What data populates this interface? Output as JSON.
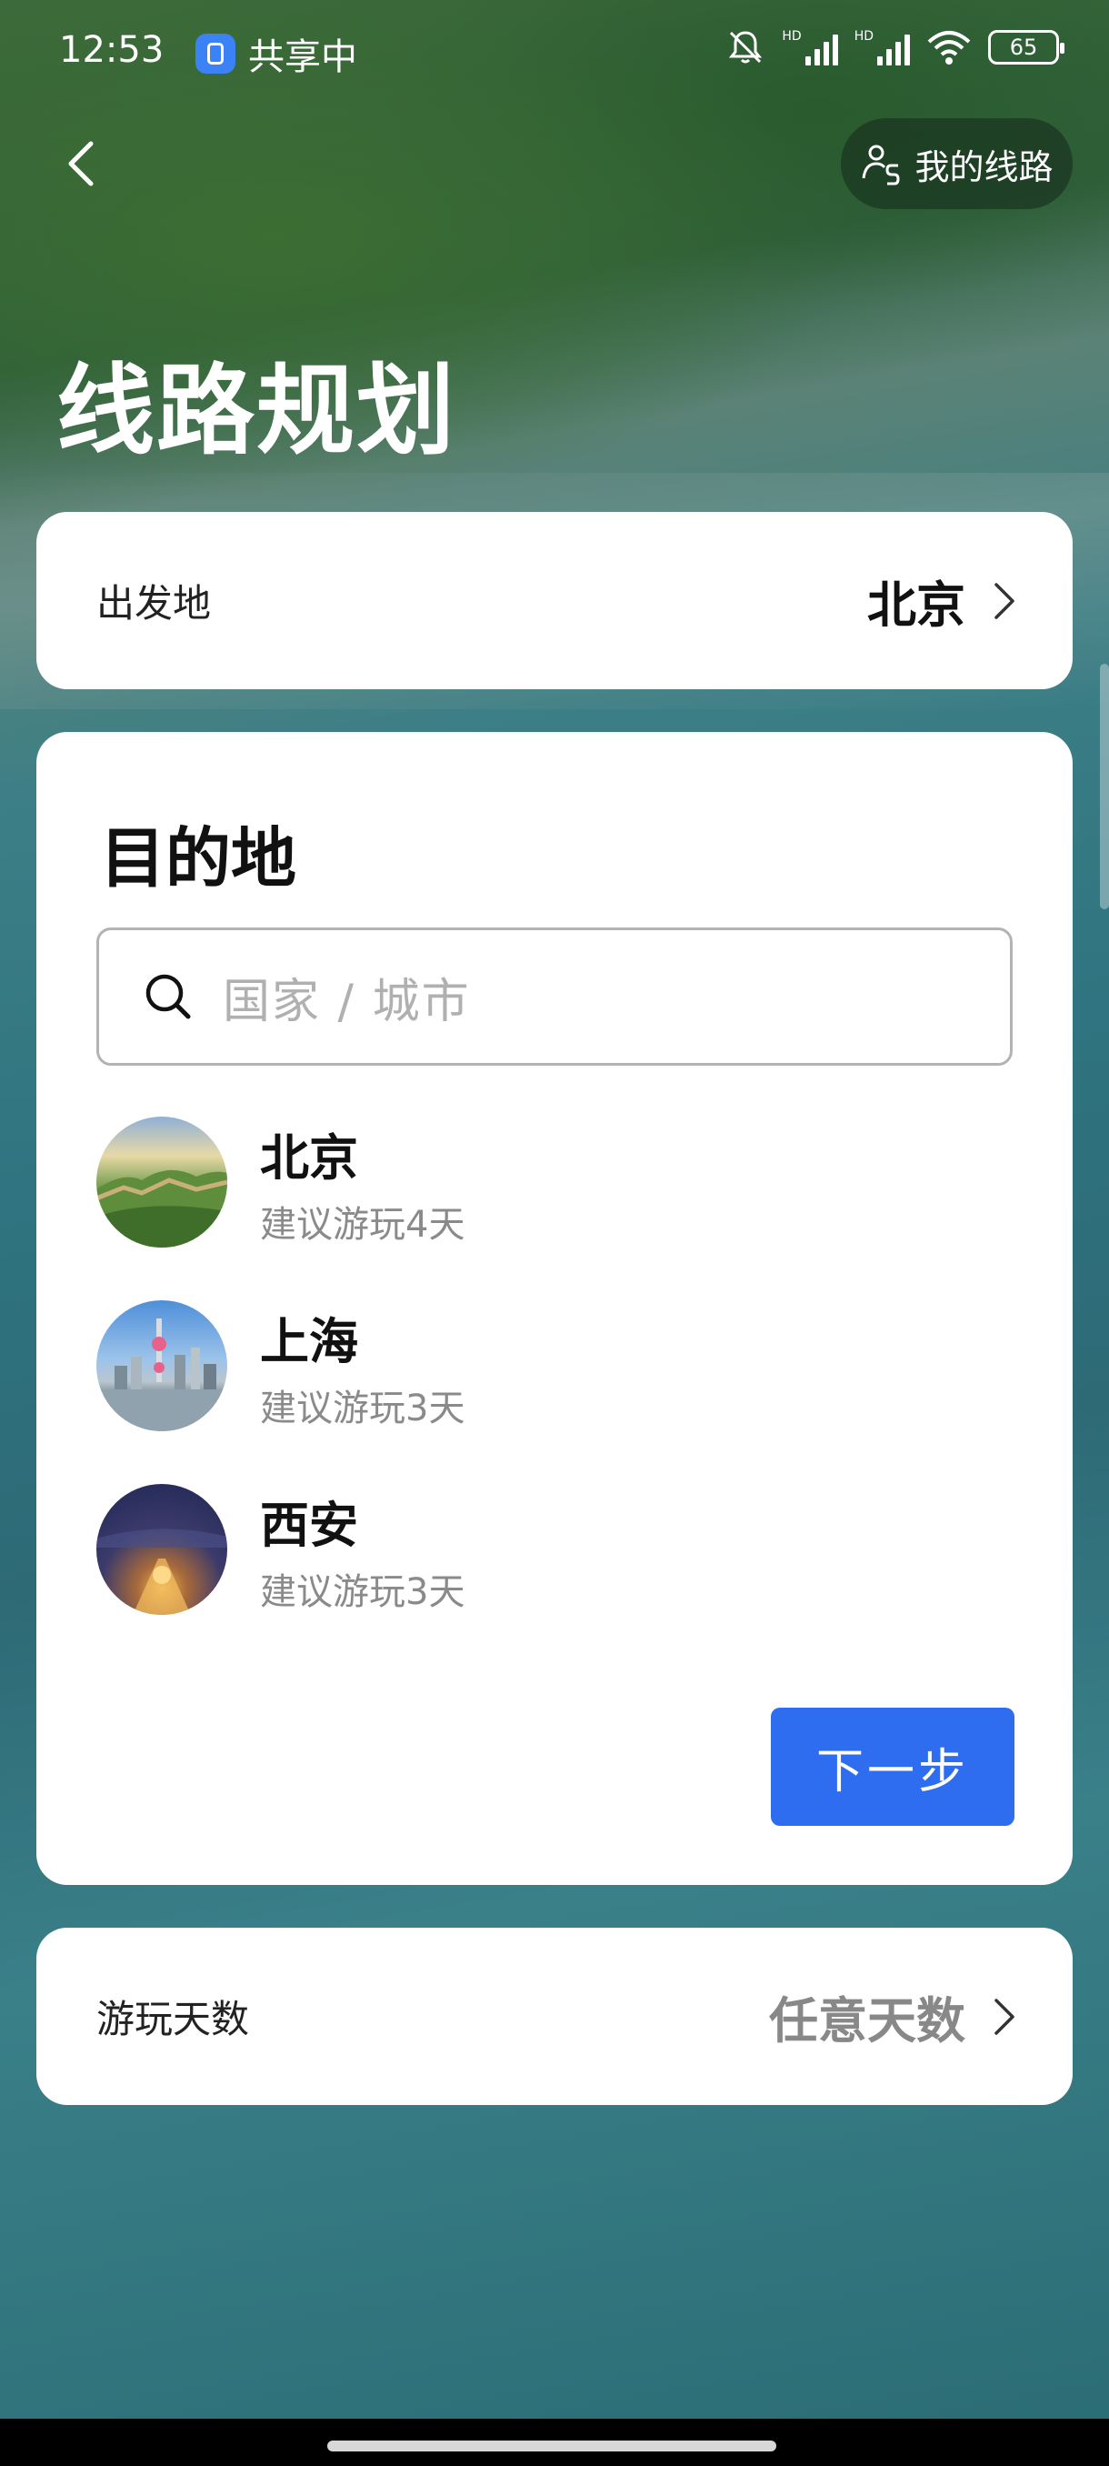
{
  "status_bar": {
    "time": "12:53",
    "share_label": "共享中",
    "battery": "65",
    "hd1": "HD",
    "hd2": "HD"
  },
  "header": {
    "my_routes_label": "我的线路",
    "title": "线路规划"
  },
  "departure": {
    "label": "出发地",
    "value": "北京"
  },
  "destination": {
    "title": "目的地",
    "search_placeholder": "国家 / 城市",
    "cities": [
      {
        "name": "北京",
        "suggestion": "建议游玩4天",
        "icon": "great-wall-photo"
      },
      {
        "name": "上海",
        "suggestion": "建议游玩3天",
        "icon": "shanghai-skyline-photo"
      },
      {
        "name": "西安",
        "suggestion": "建议游玩3天",
        "icon": "xian-night-photo"
      }
    ],
    "next_label": "下一步"
  },
  "days": {
    "label": "游玩天数",
    "value": "任意天数"
  },
  "colors": {
    "primary_button": "#2f6df0",
    "share_badge": "#3b82f6"
  }
}
